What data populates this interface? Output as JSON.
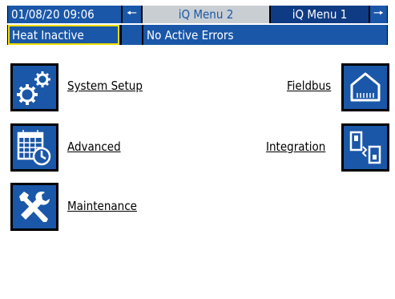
{
  "status_bar": {
    "datetime": "01/08/20 09:06",
    "prev_arrow": "🠔",
    "tab_active": "iQ Menu 2",
    "tab_other": "iQ Menu 1",
    "next_arrow": "🠖"
  },
  "info_bar": {
    "heat_status": "Heat Inactive",
    "error_status": "No Active Errors"
  },
  "menu": {
    "system_setup": "System Setup",
    "advanced": "Advanced",
    "maintenance": "Maintenance",
    "fieldbus": "Fieldbus",
    "integration": "Integration"
  },
  "icons": {
    "system_setup": "gears-icon",
    "advanced": "calendar-clock-icon",
    "maintenance": "wrench-screwdriver-icon",
    "fieldbus": "network-port-icon",
    "integration": "integration-icon"
  },
  "colors": {
    "tile_blue": "#1a57a8",
    "tab_grey": "#c9ced3",
    "tab_navy": "#0f3b84",
    "highlight_yellow": "#f2de00"
  }
}
